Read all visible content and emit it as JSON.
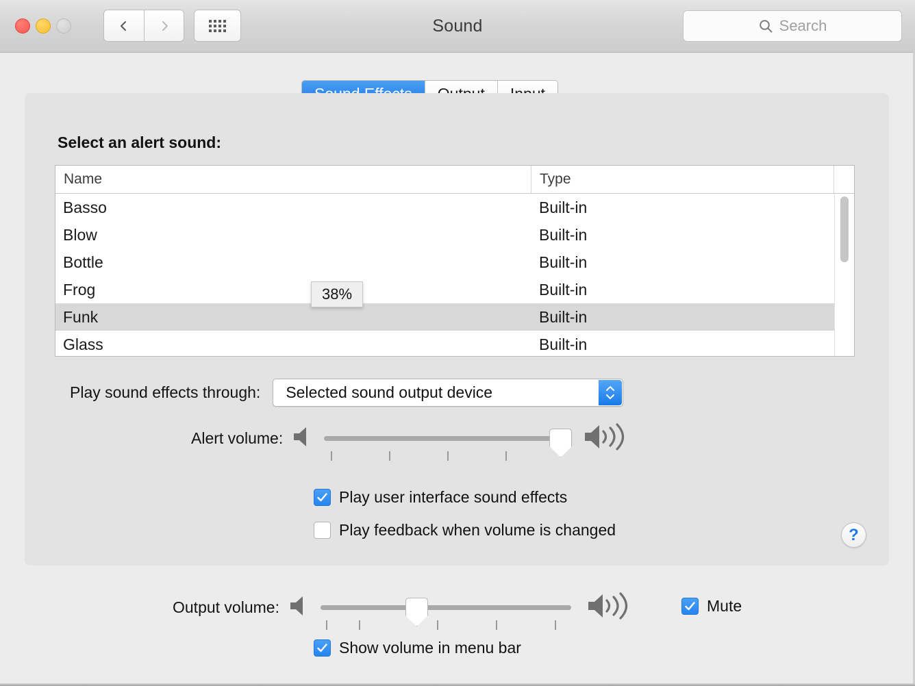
{
  "window": {
    "title": "Sound",
    "traffic_lights": [
      "close",
      "minimize",
      "zoom"
    ],
    "nav": {
      "back": "back-chevron",
      "forward": "forward-chevron",
      "grid": "show-all-grid"
    },
    "search": {
      "placeholder": "Search",
      "value": "",
      "icon": "search-icon"
    }
  },
  "tabs": [
    {
      "label": "Sound Effects",
      "active": true
    },
    {
      "label": "Output",
      "active": false
    },
    {
      "label": "Input",
      "active": false
    }
  ],
  "main": {
    "section_title": "Select an alert sound:",
    "table": {
      "columns": [
        "Name",
        "Type"
      ],
      "rows": [
        {
          "name": "Basso",
          "type": "Built-in",
          "selected": false
        },
        {
          "name": "Blow",
          "type": "Built-in",
          "selected": false
        },
        {
          "name": "Bottle",
          "type": "Built-in",
          "selected": false
        },
        {
          "name": "Frog",
          "type": "Built-in",
          "selected": false
        },
        {
          "name": "Funk",
          "type": "Built-in",
          "selected": true
        },
        {
          "name": "Glass",
          "type": "Built-in",
          "selected": false
        }
      ]
    },
    "tooltip": {
      "text": "38%"
    },
    "play_through": {
      "label": "Play sound effects through:",
      "value": "Selected sound output device"
    },
    "alert_volume": {
      "label": "Alert volume:",
      "percent": 100,
      "tick_count": 4,
      "low_icon": "speaker-mute-icon",
      "high_icon": "speaker-loud-icon"
    },
    "checkboxes": {
      "ui_sounds": {
        "label": "Play user interface sound effects",
        "checked": true
      },
      "feedback": {
        "label": "Play feedback when volume is changed",
        "checked": false
      }
    },
    "help": {
      "label": "?",
      "icon": "help-icon"
    }
  },
  "footer": {
    "output_volume": {
      "label": "Output volume:",
      "percent": 38,
      "tick_count": 5,
      "low_icon": "speaker-mute-icon",
      "high_icon": "speaker-loud-icon"
    },
    "mute": {
      "label": "Mute",
      "checked": true
    },
    "show_in_menu_bar": {
      "label": "Show volume in menu bar",
      "checked": true
    }
  },
  "colors": {
    "accent_blue": "#1a7aea",
    "tab_active_blue": "#2a86ec",
    "selected_row": "#d8d8d8",
    "panel_bg": "#e3e3e3",
    "window_bg": "#ececec"
  }
}
